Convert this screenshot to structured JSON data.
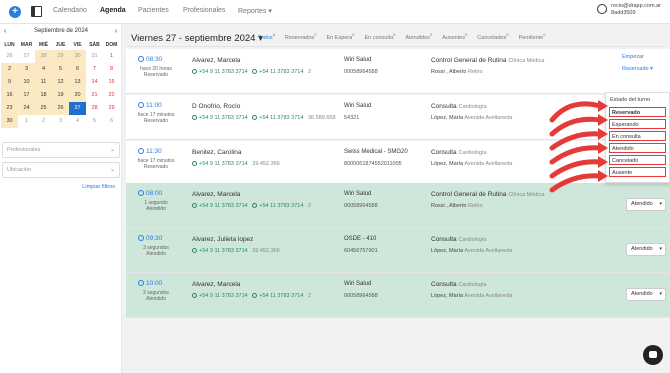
{
  "topnav": {
    "items": [
      "Calendario",
      "Agenda",
      "Pacientes",
      "Profesionales",
      "Reportes"
    ],
    "active": "Agenda",
    "user_email": "rocio@drapp.com.ar",
    "user_id": "8add3509"
  },
  "calendar": {
    "month_label": "Septiembre de 2024",
    "weekdays": [
      "LUN",
      "MAR",
      "MIÉ",
      "JUE",
      "VIE",
      "SÁB",
      "DOM"
    ],
    "weeks": [
      [
        "26",
        "27",
        "28",
        "29",
        "30",
        "31",
        "1"
      ],
      [
        "2",
        "3",
        "4",
        "5",
        "6",
        "7",
        "8"
      ],
      [
        "9",
        "10",
        "11",
        "12",
        "13",
        "14",
        "15"
      ],
      [
        "16",
        "17",
        "18",
        "19",
        "20",
        "21",
        "22"
      ],
      [
        "23",
        "24",
        "25",
        "26",
        "27",
        "28",
        "29"
      ],
      [
        "30",
        "1",
        "2",
        "3",
        "4",
        "5",
        "6"
      ]
    ],
    "selected": "27"
  },
  "filters": {
    "professionals_placeholder": "Profesionales",
    "location_placeholder": "Ubicación",
    "clear_label": "Limpiar filtros"
  },
  "header": {
    "date_title": "Viernes 27 - septiembre 2024",
    "tabs": [
      {
        "label": "Todos",
        "count": "6"
      },
      {
        "label": "Reservados",
        "count": "2"
      },
      {
        "label": "En Espera",
        "count": "0"
      },
      {
        "label": "En consulta",
        "count": "0"
      },
      {
        "label": "Atendidos",
        "count": "3"
      },
      {
        "label": "Ausentes",
        "count": "0"
      },
      {
        "label": "Cancelados",
        "count": "0"
      },
      {
        "label": "Pendiente",
        "count": "0"
      }
    ]
  },
  "appointments": [
    {
      "time": "08:30",
      "ago": "hace 20 horas",
      "status": "Reservado",
      "name": "Alvarez, Marcela",
      "phone1": "+54 9 11 3783 3714",
      "phone2": "+54 11 3783 3714",
      "phone_count": "2",
      "insurance": "Wiri Salud",
      "insurance_num": "00058964588",
      "specialty": "Control General de Rutina",
      "place": "Clínica Médica",
      "doctor": "Rossi , Alberto",
      "location": "Retiro",
      "button": "Reservado"
    },
    {
      "time": "11:00",
      "ago": "hace 17 minutos",
      "status": "Reservado",
      "name": "D Onofrio, Rocío",
      "phone1": "+54 9 11 3783 3714",
      "phone2": "+54 11 3783 3714",
      "phone_count": "36.589.658",
      "insurance": "Wiri Salud",
      "insurance_num": "54321",
      "specialty": "Consulta",
      "place": "Cardiología",
      "doctor": "López, María",
      "location": "Avenida Avellaneda",
      "button": ""
    },
    {
      "time": "11:30",
      "ago": "hace 17 minutos",
      "status": "Reservado",
      "name": "Benitez, Carolina",
      "phone1": "+54 9 11 3783 3714",
      "phone2": "",
      "phone_count": "39.452.366",
      "insurance": "Swiss Medical - SMG20",
      "insurance_num": "8000061874552011005",
      "specialty": "Consulta",
      "place": "Cardiología",
      "doctor": "López, María",
      "location": "Avenida Avellaneda",
      "button": ""
    },
    {
      "time": "08:00",
      "ago": "1 segundo",
      "status": "Atendido",
      "name": "Alvarez, Marcela",
      "phone1": "+54 9 11 3783 3714",
      "phone2": "+54 11 3783 3714",
      "phone_count": "2",
      "insurance": "Wiri Salud",
      "insurance_num": "00058964588",
      "specialty": "Control General de Rutina",
      "place": "Clínica Médica",
      "doctor": "Rossi , Alberto",
      "location": "Retiro",
      "button": "Atendido"
    },
    {
      "time": "09:30",
      "ago": "3 segundos",
      "status": "Atendido",
      "name": "Alvarez, Julieta lopez",
      "phone1": "+54 9 11 3783 3714",
      "phone2": "",
      "phone_count": "39.452.366",
      "insurance": "OSDE - 410",
      "insurance_num": "60456757901",
      "specialty": "Consulta",
      "place": "Cardiología",
      "doctor": "López, María",
      "location": "Avenida Avellaneda",
      "button": "Atendido"
    },
    {
      "time": "10:00",
      "ago": "2 segundos",
      "status": "Atendido",
      "name": "Alvarez, Marcela",
      "phone1": "+54 9 11 3783 3714",
      "phone2": "+54 11 3783 3714",
      "phone_count": "2",
      "insurance": "Wiri Salud",
      "insurance_num": "00058964588",
      "specialty": "Consulta",
      "place": "Cardiología",
      "doctor": "López, María",
      "location": "Avenida Avellaneda",
      "button": "Atendido"
    }
  ],
  "row0_actions": {
    "start": "Empezar"
  },
  "status_menu": {
    "title": "Estado del turno",
    "options": [
      "Reservado",
      "Esperando",
      "En consulta",
      "Atendido",
      "Cancelado",
      "Ausente"
    ]
  },
  "colors": {
    "accent": "#2a7de1",
    "attended_row": "#cfe6da",
    "annotation": "#e53a3a"
  }
}
